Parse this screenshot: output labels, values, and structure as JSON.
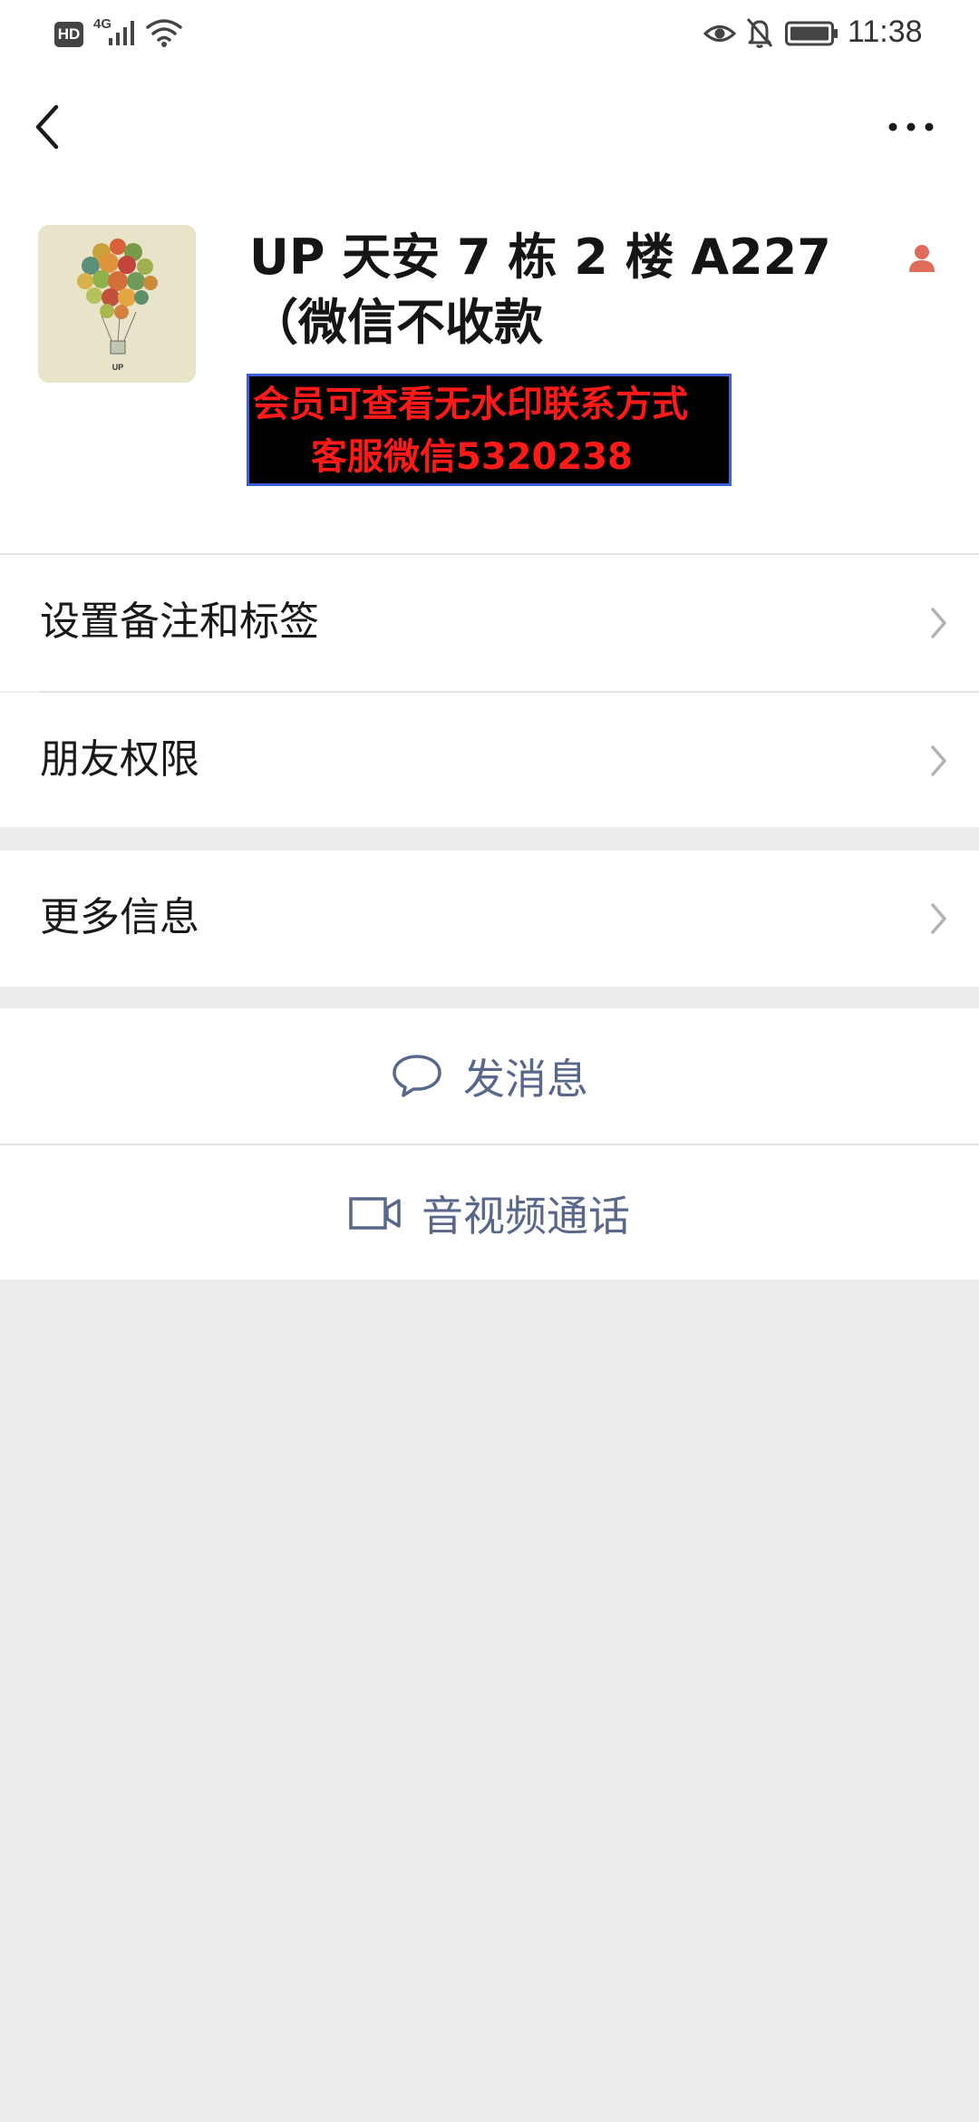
{
  "status_bar": {
    "hd_badge": "HD",
    "network": "4G",
    "time": "11:38",
    "icons": [
      "signal-icon",
      "wifi-icon",
      "eye-icon",
      "bell-off-icon",
      "battery-icon"
    ]
  },
  "nav": {
    "back_icon": "chevron-left-icon",
    "more_icon": "more-icon"
  },
  "profile": {
    "name": "UP 天安 7 栋 2 楼 A227（微信不收款",
    "watermark_line1": "会员可查看无水印联系方式",
    "watermark_line2": "客服微信5320238",
    "badge_icon": "contact-icon"
  },
  "menu": {
    "remark_tags": "设置备注和标签",
    "friend_permissions": "朋友权限",
    "more_info": "更多信息"
  },
  "actions": {
    "send_message": "发消息",
    "video_call": "音视频通话"
  },
  "colors": {
    "page_bg": "#ededed",
    "card_bg": "#ffffff",
    "action_text": "#59688a",
    "watermark_text": "#ff1a1a",
    "watermark_bg": "#000000",
    "watermark_border": "#3b62d8"
  }
}
